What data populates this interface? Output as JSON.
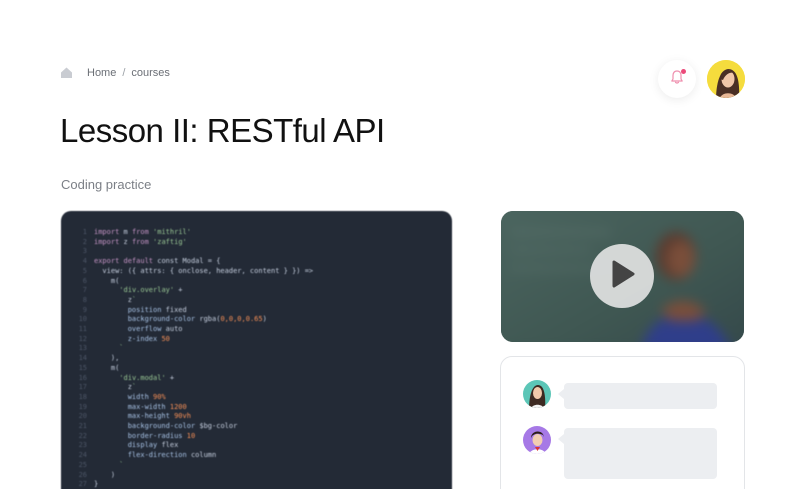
{
  "breadcrumb": {
    "home": "Home",
    "separator": "/",
    "current": "courses",
    "icon": "home-icon"
  },
  "page": {
    "title": "Lesson II: RESTful API",
    "subtitle": "Coding practice"
  },
  "header": {
    "notification_icon": "bell-icon",
    "has_unread": true,
    "avatar": "user-avatar"
  },
  "colors": {
    "accent": "#ec4a7a",
    "code_bg": "#232a36",
    "bubble": "#eceef1"
  },
  "code": {
    "lines": [
      {
        "n": "1",
        "html": "<span class='tok-kw'>import</span> m <span class='tok-kw'>from</span> <span class='tok-str'>'mithril'</span>"
      },
      {
        "n": "2",
        "html": "<span class='tok-kw'>import</span> z <span class='tok-kw'>from</span> <span class='tok-str'>'zaftig'</span>"
      },
      {
        "n": "3",
        "html": ""
      },
      {
        "n": "4",
        "html": "<span class='tok-kw'>export default</span> const Modal = {"
      },
      {
        "n": "5",
        "html": "  view: ({ attrs: { onclose, header, content } }) =>"
      },
      {
        "n": "6",
        "html": "    m("
      },
      {
        "n": "7",
        "html": "      <span class='tok-str'>'div.overlay'</span> +"
      },
      {
        "n": "8",
        "html": "        z<span class='tok-str'>`</span>"
      },
      {
        "n": "9",
        "html": "        <span class='tok-id'>position</span> fixed"
      },
      {
        "n": "10",
        "html": "        <span class='tok-id'>background-color</span> rgba(<span class='tok-num'>0,0,0,0.65</span>)"
      },
      {
        "n": "11",
        "html": "        <span class='tok-id'>overflow</span> auto"
      },
      {
        "n": "12",
        "html": "        <span class='tok-id'>z-index</span> <span class='tok-num'>50</span>"
      },
      {
        "n": "13",
        "html": "      <span class='tok-str'>`</span>"
      },
      {
        "n": "14",
        "html": "    ),"
      },
      {
        "n": "15",
        "html": "    m("
      },
      {
        "n": "16",
        "html": "      <span class='tok-str'>'div.modal'</span> +"
      },
      {
        "n": "17",
        "html": "        z<span class='tok-str'>`</span>"
      },
      {
        "n": "18",
        "html": "        <span class='tok-id'>width</span> <span class='tok-num'>90%</span>"
      },
      {
        "n": "19",
        "html": "        <span class='tok-id'>max-width</span> <span class='tok-num'>1200</span>"
      },
      {
        "n": "20",
        "html": "        <span class='tok-id'>max-height</span> <span class='tok-num'>90vh</span>"
      },
      {
        "n": "21",
        "html": "        <span class='tok-id'>background-color</span> $bg-color"
      },
      {
        "n": "22",
        "html": "        <span class='tok-id'>border-radius</span> <span class='tok-num'>10</span>"
      },
      {
        "n": "23",
        "html": "        <span class='tok-id'>display</span> flex"
      },
      {
        "n": "24",
        "html": "        <span class='tok-id'>flex-direction</span> column"
      },
      {
        "n": "25",
        "html": "      <span class='tok-str'>`</span>"
      },
      {
        "n": "26",
        "html": "    )"
      },
      {
        "n": "27",
        "html": "}"
      }
    ]
  },
  "video": {
    "play_icon": "play-icon"
  },
  "chat": {
    "messages": [
      {
        "avatar": "woman-avatar"
      },
      {
        "avatar": "man-avatar"
      }
    ]
  }
}
